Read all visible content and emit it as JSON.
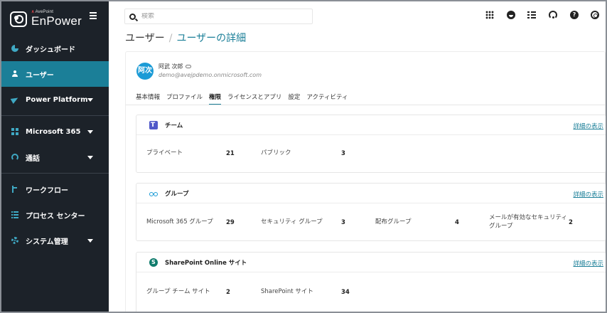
{
  "app": {
    "vendor": "AvePoint",
    "product": "EnPower"
  },
  "sidebar": {
    "items": [
      {
        "label": "ダッシュボード",
        "icon": "dashboard-icon",
        "active": false,
        "expandable": false
      },
      {
        "label": "ユーザー",
        "icon": "user-icon",
        "active": true,
        "expandable": false
      },
      {
        "label": "Power Platform",
        "icon": "power-platform-icon",
        "active": false,
        "expandable": true
      },
      {
        "label": "Microsoft 365",
        "icon": "microsoft-365-icon",
        "active": false,
        "expandable": true
      },
      {
        "label": "通話",
        "icon": "call-icon",
        "active": false,
        "expandable": true
      },
      {
        "label": "ワークフロー",
        "icon": "workflow-icon",
        "active": false,
        "expandable": false
      },
      {
        "label": "プロセス センター",
        "icon": "process-center-icon",
        "active": false,
        "expandable": false
      },
      {
        "label": "システム管理",
        "icon": "system-admin-icon",
        "active": false,
        "expandable": true
      }
    ]
  },
  "topbar": {
    "search_placeholder": "検索",
    "tools": [
      "apps-icon",
      "feedback-icon",
      "tasks-icon",
      "support-icon",
      "help-icon",
      "lifebuoy-icon"
    ],
    "help_glyph": "?"
  },
  "breadcrumb": {
    "parent": "ユーザー",
    "separator": "/",
    "current": "ユーザーの詳細"
  },
  "user": {
    "initials": "阿次",
    "name": "阿武 次郎",
    "email": "demo@avejpdemo.onmicrosoft.com",
    "avatar_color": "#1b9bd6"
  },
  "tabs": [
    {
      "label": "基本情報",
      "active": false
    },
    {
      "label": "プロファイル",
      "active": false
    },
    {
      "label": "権限",
      "active": true
    },
    {
      "label": "ライセンスとアプリ",
      "active": false
    },
    {
      "label": "設定",
      "active": false
    },
    {
      "label": "アクティビティ",
      "active": false
    }
  ],
  "cards": {
    "teams": {
      "title": "チーム",
      "link": "詳細の表示",
      "stats": [
        {
          "label": "プライベート",
          "value": "21"
        },
        {
          "label": "パブリック",
          "value": "3"
        }
      ]
    },
    "groups": {
      "title": "グループ",
      "link": "詳細の表示",
      "stats": [
        {
          "label": "Microsoft 365 グループ",
          "value": "29"
        },
        {
          "label": "セキュリティ グループ",
          "value": "3"
        },
        {
          "label": "配布グループ",
          "value": "4"
        },
        {
          "label": "メールが有効なセキュリティ グループ",
          "value": "2"
        }
      ]
    },
    "sharepoint": {
      "title": "SharePoint Online サイト",
      "link": "詳細の表示",
      "stats": [
        {
          "label": "グループ チーム サイト",
          "value": "2"
        },
        {
          "label": "SharePoint サイト",
          "value": "34"
        }
      ]
    }
  },
  "colors": {
    "sidebar_bg": "#1c2229",
    "accent": "#1b7f98",
    "active_item_bg": "#1b7f98"
  }
}
